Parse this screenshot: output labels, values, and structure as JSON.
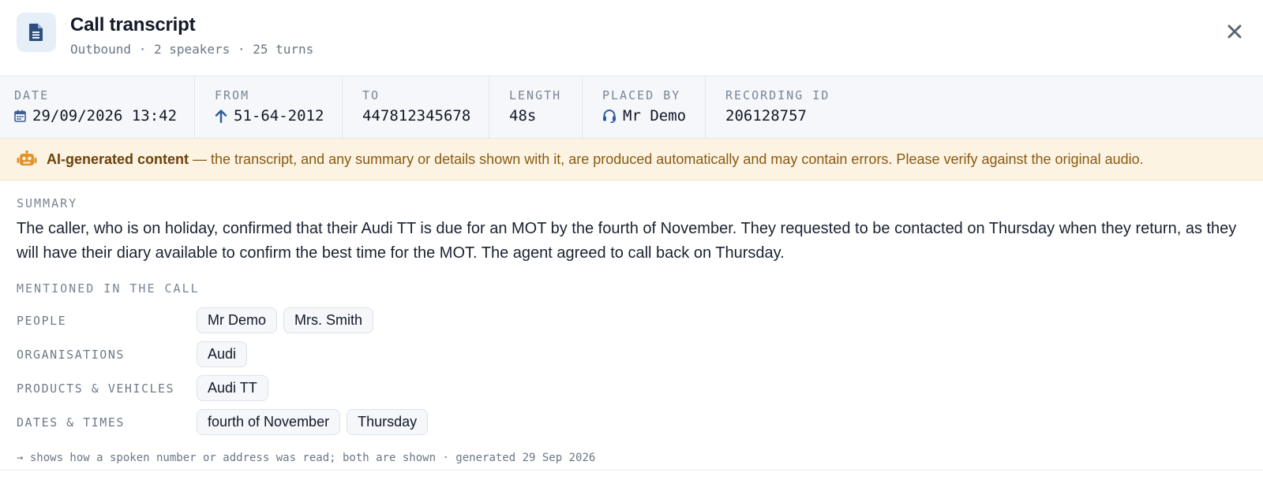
{
  "header": {
    "title": "Call transcript",
    "subtitle": "Outbound · 2 speakers · 25 turns",
    "icons": {
      "badge": "document-icon",
      "close": "close-icon"
    }
  },
  "meta": {
    "date": {
      "label": "DATE",
      "value": "29/09/2026 13:42",
      "icon": "calendar-icon"
    },
    "from": {
      "label": "FROM",
      "value": "51-64-2012",
      "icon": "arrow-up-icon"
    },
    "to": {
      "label": "TO",
      "value": "447812345678"
    },
    "length": {
      "label": "LENGTH",
      "value": "48s"
    },
    "placed_by": {
      "label": "PLACED BY",
      "value": "Mr Demo",
      "icon": "headset-icon"
    },
    "recording_id": {
      "label": "RECORDING ID",
      "value": "206128757"
    }
  },
  "ai_notice": {
    "icon": "robot-icon",
    "title": "AI-generated content",
    "text": " — the transcript, and any summary or details shown with it, are produced automatically and may contain errors. Please verify against the original audio."
  },
  "summary": {
    "label": "SUMMARY",
    "text": "The caller, who is on holiday, confirmed that their Audi TT is due for an MOT by the fourth of November. They requested to be contacted on Thursday when they return, as they will have their diary available to confirm the best time for the MOT. The agent agreed to call back on Thursday."
  },
  "mentioned": {
    "label": "MENTIONED IN THE CALL",
    "rows": [
      {
        "label": "PEOPLE",
        "chips": [
          "Mr Demo",
          "Mrs. Smith"
        ]
      },
      {
        "label": "ORGANISATIONS",
        "chips": [
          "Audi"
        ]
      },
      {
        "label": "PRODUCTS & VEHICLES",
        "chips": [
          "Audi TT"
        ]
      },
      {
        "label": "DATES & TIMES",
        "chips": [
          "fourth of November",
          "Thursday"
        ]
      }
    ]
  },
  "footnote": "→ shows how a spoken number or address was read; both are shown · generated 29 Sep 2026",
  "colors": {
    "accent": "#2f5d9b",
    "banner_bg": "#fcf3e2",
    "banner_text": "#8a5a12",
    "robot_icon": "#e0952a"
  }
}
